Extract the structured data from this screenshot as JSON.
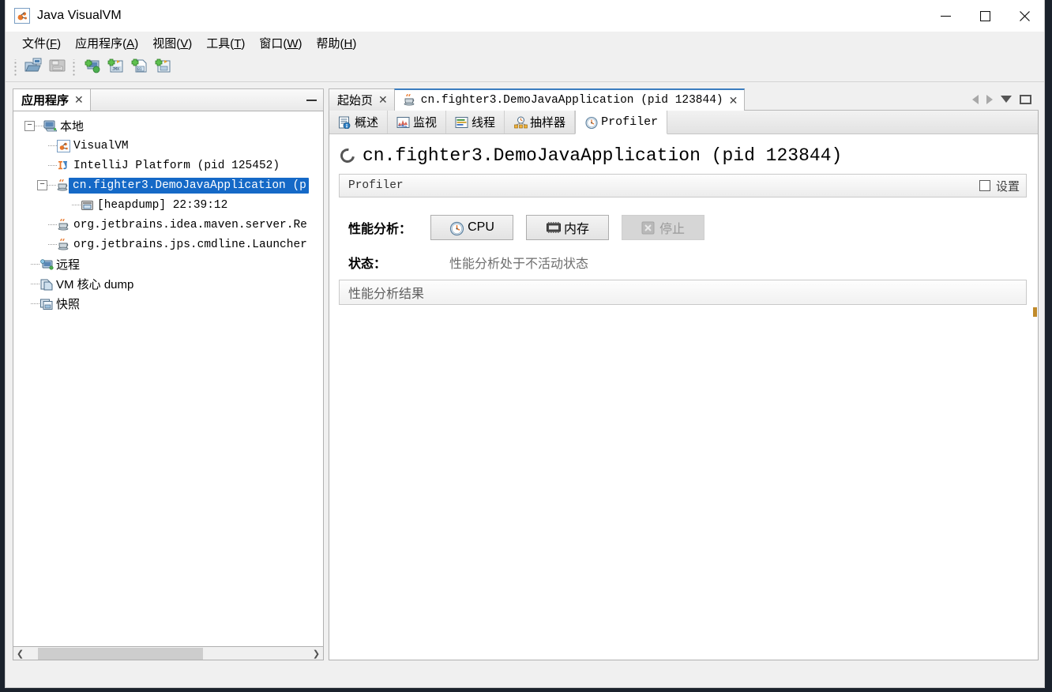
{
  "window": {
    "title": "Java VisualVM",
    "app_icon": "visualvm-icon",
    "controls": {
      "minimize": "—",
      "maximize": "□",
      "close": "✕"
    }
  },
  "menubar": {
    "items": [
      {
        "name": "file",
        "label_prefix": "文件(",
        "mnemonic": "F",
        "label_suffix": ")"
      },
      {
        "name": "applications",
        "label_prefix": "应用程序(",
        "mnemonic": "A",
        "label_suffix": ")"
      },
      {
        "name": "view",
        "label_prefix": "视图(",
        "mnemonic": "V",
        "label_suffix": ")"
      },
      {
        "name": "tools",
        "label_prefix": "工具(",
        "mnemonic": "T",
        "label_suffix": ")"
      },
      {
        "name": "window",
        "label_prefix": "窗口(",
        "mnemonic": "W",
        "label_suffix": ")"
      },
      {
        "name": "help",
        "label_prefix": "帮助(",
        "mnemonic": "H",
        "label_suffix": ")"
      }
    ]
  },
  "toolbar": {
    "buttons": [
      {
        "name": "open-snapshot-button",
        "icon": "open-folder-icon"
      },
      {
        "name": "save-snapshot-button",
        "icon": "save-disk-icon"
      },
      {
        "name": "add-remote-host-button",
        "icon": "add-host-icon"
      },
      {
        "name": "add-jmx-connection-button",
        "icon": "add-jmx-icon"
      },
      {
        "name": "add-vm-coredump-button",
        "icon": "add-coredump-icon"
      },
      {
        "name": "add-snapshot-button",
        "icon": "add-snapshot-icon"
      }
    ]
  },
  "sidebar": {
    "tab_label": "应用程序",
    "tab_close": "✕",
    "minimize": "minimize-icon",
    "tree": [
      {
        "name": "local",
        "label": "本地",
        "icon": "computer-icon",
        "depth": 0,
        "expanded": true,
        "selected": false,
        "mono": false
      },
      {
        "name": "visualvm",
        "label": "VisualVM",
        "icon": "visualvm-icon",
        "depth": 1,
        "expanded": null,
        "selected": false,
        "mono": true
      },
      {
        "name": "intellij-platform",
        "label": "IntelliJ Platform (pid 125452)",
        "icon": "intellij-icon",
        "depth": 1,
        "expanded": null,
        "selected": false,
        "mono": true
      },
      {
        "name": "demo-java-application",
        "label": "cn.fighter3.DemoJavaApplication (p",
        "icon": "java-coffee-icon",
        "depth": 1,
        "expanded": true,
        "selected": true,
        "mono": true
      },
      {
        "name": "heapdump",
        "label": "[heapdump] 22:39:12",
        "icon": "heapdump-icon",
        "depth": 2,
        "expanded": null,
        "selected": false,
        "mono": true
      },
      {
        "name": "maven-server",
        "label": "org.jetbrains.idea.maven.server.Re",
        "icon": "java-coffee-icon",
        "depth": 1,
        "expanded": null,
        "selected": false,
        "mono": true
      },
      {
        "name": "jps-launcher",
        "label": "org.jetbrains.jps.cmdline.Launcher",
        "icon": "java-coffee-icon",
        "depth": 1,
        "expanded": null,
        "selected": false,
        "mono": true
      },
      {
        "name": "remote",
        "label": "远程",
        "icon": "remote-host-icon",
        "depth": 0,
        "expanded": null,
        "selected": false,
        "mono": false
      },
      {
        "name": "vm-coredump",
        "label": "VM 核心 dump",
        "icon": "coredump-icon",
        "depth": 0,
        "expanded": null,
        "selected": false,
        "mono": false
      },
      {
        "name": "snapshots",
        "label": "快照",
        "icon": "snapshot-icon",
        "depth": 0,
        "expanded": null,
        "selected": false,
        "mono": false
      }
    ],
    "hscroll": {
      "left_arrow": "❮",
      "right_arrow": "❯"
    }
  },
  "main": {
    "doc_tabs": [
      {
        "name": "start-page",
        "label": "起始页",
        "icon": null,
        "active": false,
        "close": "✕",
        "mono": false
      },
      {
        "name": "demo-java-application",
        "label": "cn.fighter3.DemoJavaApplication (pid 123844)",
        "icon": "java-coffee-icon",
        "active": true,
        "close": "✕",
        "mono": true
      }
    ],
    "tab_controls": {
      "scroll_left": "scroll-left-icon",
      "scroll_right": "scroll-right-icon",
      "dropdown": "chevron-down-icon",
      "maximize": "maximize-icon"
    },
    "sub_tabs": [
      {
        "name": "overview",
        "label": "概述",
        "icon": "overview-icon",
        "active": false,
        "mono": false
      },
      {
        "name": "monitor",
        "label": "监视",
        "icon": "monitor-chart-icon",
        "active": false,
        "mono": false
      },
      {
        "name": "threads",
        "label": "线程",
        "icon": "threads-icon",
        "active": false,
        "mono": false
      },
      {
        "name": "sampler",
        "label": "抽样器",
        "icon": "sampler-icon",
        "active": false,
        "mono": false
      },
      {
        "name": "profiler",
        "label": "Profiler",
        "icon": "profiler-clock-icon",
        "active": true,
        "mono": true
      }
    ],
    "heading": {
      "icon": "loading-spinner-icon",
      "text": "cn.fighter3.DemoJavaApplication (pid 123844)"
    },
    "profiler_section": {
      "title": "Profiler",
      "settings_checkbox_label": "设置",
      "settings_checked": false
    },
    "form": {
      "profiling_label": "性能分析：",
      "buttons": [
        {
          "name": "cpu-profile-button",
          "label": "CPU",
          "icon": "cpu-clock-icon",
          "disabled": false
        },
        {
          "name": "memory-profile-button",
          "label": "内存",
          "icon": "memory-chip-icon",
          "disabled": false
        },
        {
          "name": "stop-profile-button",
          "label": "停止",
          "icon": "stop-x-icon",
          "disabled": true
        }
      ],
      "status_label": "状态：",
      "status_value": "性能分析处于不活动状态"
    },
    "results_bar": {
      "title": "性能分析结果"
    }
  },
  "colors": {
    "selection_blue": "#1569c7",
    "active_tab_border": "#3b7dbf",
    "window_bg": "#f0f0f0",
    "panel_white": "#ffffff",
    "desktop": "#1b222c"
  }
}
